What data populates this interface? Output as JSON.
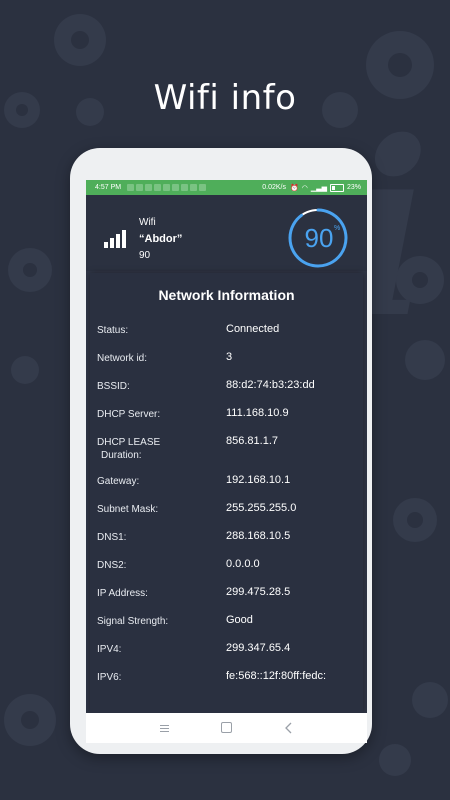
{
  "promo": {
    "title": "Wifi info"
  },
  "status_bar": {
    "time": "4:57 PM",
    "speed": "0.02K/s",
    "battery": "23%"
  },
  "wifi": {
    "label": "Wifi",
    "ssid": "“Abdor”",
    "strength": "90",
    "gauge_value": "90",
    "gauge_unit": "%",
    "gauge_level_percent": 90
  },
  "network": {
    "title": "Network Information",
    "rows": [
      {
        "key": "Status:",
        "value": "Connected"
      },
      {
        "key": "Network id:",
        "value": "3"
      },
      {
        "key": "BSSID:",
        "value": "88:d2:74:b3:23:dd"
      },
      {
        "key": "DHCP Server:",
        "value": "111.168.10.9"
      },
      {
        "key": "DHCP LEASE",
        "key2": "Duration:",
        "value": "856.81.1.7"
      },
      {
        "key": "Gateway:",
        "value": "192.168.10.1"
      },
      {
        "key": "Subnet Mask:",
        "value": "255.255.255.0"
      },
      {
        "key": "DNS1:",
        "value": "288.168.10.5"
      },
      {
        "key": "DNS2:",
        "value": "0.0.0.0"
      },
      {
        "key": "IP Address:",
        "value": "299.475.28.5"
      },
      {
        "key": "Signal Strength:",
        "value": "Good"
      },
      {
        "key": "IPV4:",
        "value": "299.347.65.4"
      },
      {
        "key": "IPV6:",
        "value": "fe:568::12f:80ff:fedc:"
      }
    ]
  },
  "colors": {
    "background": "#2b3140",
    "status_bar": "#4fae5a",
    "gauge_accent": "#4aa3f0"
  }
}
